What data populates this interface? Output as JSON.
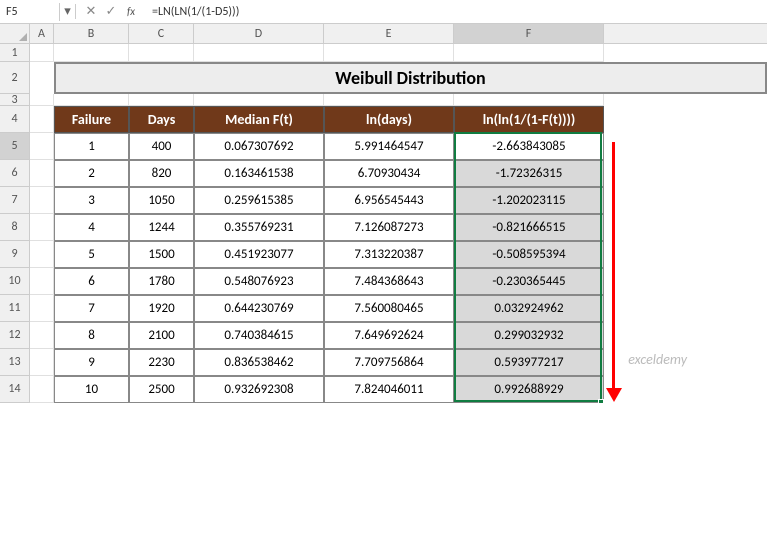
{
  "nameBox": "F5",
  "formula": "=LN(LN(1/(1-D5)))",
  "columns": [
    "A",
    "B",
    "C",
    "D",
    "E",
    "F"
  ],
  "selectedCol": "F",
  "rows": [
    "1",
    "2",
    "3",
    "4",
    "5",
    "6",
    "7",
    "8",
    "9",
    "10",
    "11",
    "12",
    "13",
    "14"
  ],
  "selectedRow": "5",
  "title": "Weibull Distribution",
  "headers": {
    "failure": "Failure",
    "days": "Days",
    "median": "Median F(t)",
    "lndays": "ln(days)",
    "lnln": "ln(ln(1/(1-F(t))))"
  },
  "data": [
    {
      "f": "1",
      "d": "400",
      "m": "0.067307692",
      "ln": "5.991464547",
      "y": "-2.663843085"
    },
    {
      "f": "2",
      "d": "820",
      "m": "0.163461538",
      "ln": "6.70930434",
      "y": "-1.72326315"
    },
    {
      "f": "3",
      "d": "1050",
      "m": "0.259615385",
      "ln": "6.956545443",
      "y": "-1.202023115"
    },
    {
      "f": "4",
      "d": "1244",
      "m": "0.355769231",
      "ln": "7.126087273",
      "y": "-0.821666515"
    },
    {
      "f": "5",
      "d": "1500",
      "m": "0.451923077",
      "ln": "7.313220387",
      "y": "-0.508595394"
    },
    {
      "f": "6",
      "d": "1780",
      "m": "0.548076923",
      "ln": "7.484368643",
      "y": "-0.230365445"
    },
    {
      "f": "7",
      "d": "1920",
      "m": "0.644230769",
      "ln": "7.560080465",
      "y": "0.032924962"
    },
    {
      "f": "8",
      "d": "2100",
      "m": "0.740384615",
      "ln": "7.649692624",
      "y": "0.299032932"
    },
    {
      "f": "9",
      "d": "2230",
      "m": "0.836538462",
      "ln": "7.709756864",
      "y": "0.593977217"
    },
    {
      "f": "10",
      "d": "2500",
      "m": "0.932692308",
      "ln": "7.824046011",
      "y": "0.992688929"
    }
  ],
  "watermark": "exceldemy",
  "chart_data": {
    "type": "table",
    "title": "Weibull Distribution",
    "columns": [
      "Failure",
      "Days",
      "Median F(t)",
      "ln(days)",
      "ln(ln(1/(1-F(t))))"
    ],
    "rows": [
      [
        1,
        400,
        0.067307692,
        5.991464547,
        -2.663843085
      ],
      [
        2,
        820,
        0.163461538,
        6.70930434,
        -1.72326315
      ],
      [
        3,
        1050,
        0.259615385,
        6.956545443,
        -1.202023115
      ],
      [
        4,
        1244,
        0.355769231,
        7.126087273,
        -0.821666515
      ],
      [
        5,
        1500,
        0.451923077,
        7.313220387,
        -0.508595394
      ],
      [
        6,
        1780,
        0.548076923,
        7.484368643,
        -0.230365445
      ],
      [
        7,
        1920,
        0.644230769,
        7.560080465,
        0.032924962
      ],
      [
        8,
        2100,
        0.740384615,
        7.649692624,
        0.299032932
      ],
      [
        9,
        2230,
        0.836538462,
        7.709756864,
        0.593977217
      ],
      [
        10,
        2500,
        0.932692308,
        7.824046011,
        0.992688929
      ]
    ]
  }
}
